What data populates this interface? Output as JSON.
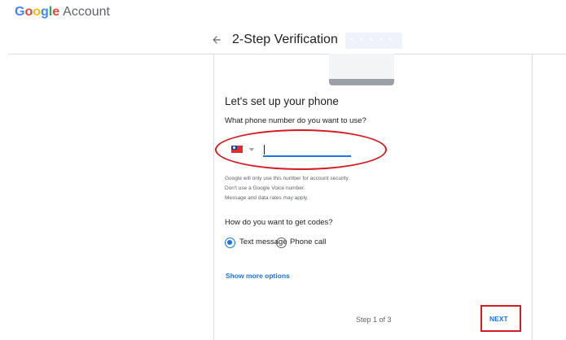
{
  "header": {
    "logo_letters": [
      "G",
      "o",
      "o",
      "g",
      "l",
      "e"
    ],
    "logo_colors": [
      "#4285F4",
      "#EA4335",
      "#FBBC05",
      "#4285F4",
      "#34A853",
      "#EA4335"
    ],
    "account_label": "Account"
  },
  "topbar": {
    "back_icon": "arrow-left-icon",
    "title": "2-Step Verification"
  },
  "setup": {
    "heading": "Let's set up your phone",
    "question": "What phone number do you want to use?",
    "country_flag": "taiwan-flag-icon",
    "phone_value": "",
    "notes": [
      "Google will only use this number for account security.",
      "Don't use a Google Voice number.",
      "Message and data rates may apply."
    ],
    "codes_question": "How do you want to get codes?",
    "options": [
      {
        "label": "Text message",
        "selected": true
      },
      {
        "label": "Phone call",
        "selected": false
      }
    ],
    "more_options": "Show more options"
  },
  "footer": {
    "step": "Step 1 of 3",
    "next_label": "NEXT"
  },
  "colors": {
    "accent": "#1a73e8",
    "annotation": "#d71920"
  }
}
